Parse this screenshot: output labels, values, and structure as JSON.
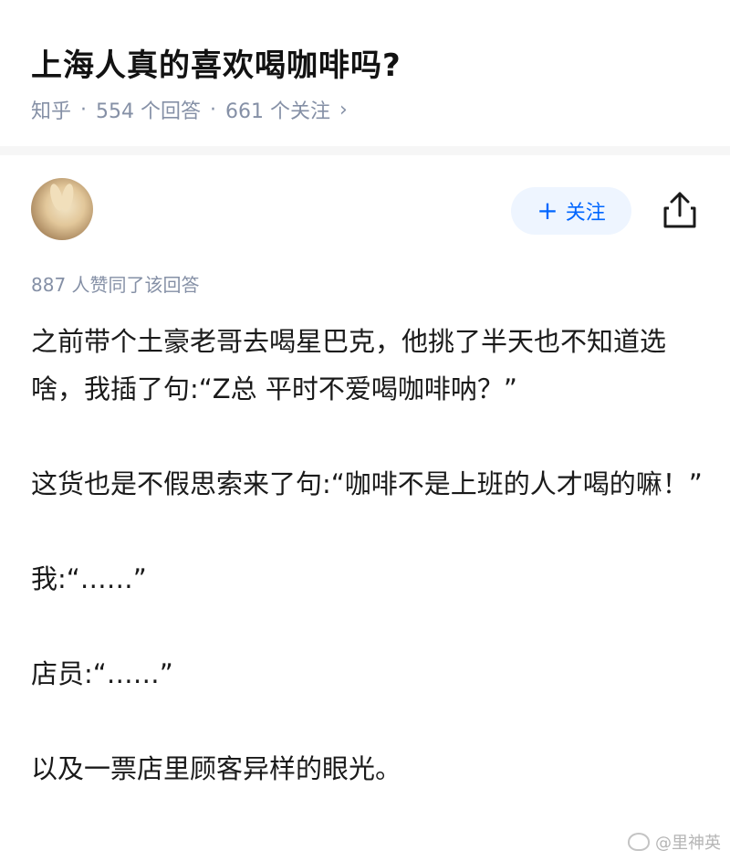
{
  "question": {
    "title": "上海人真的喜欢喝咖啡吗?",
    "source": "知乎",
    "answer_count": "554 个回答",
    "follow_count": "661 个关注",
    "separator": "·",
    "chevron": "›"
  },
  "author": {
    "name": "",
    "bio": "",
    "follow_label": "关注",
    "follow_icon": "+",
    "share_icon": "share-icon"
  },
  "upvote_note": "887 人赞同了该回答",
  "paragraphs": [
    "之前带个土豪老哥去喝星巴克，他挑了半天也不知道选啥，我插了句:“Z总 平时不爱喝咖啡呐？”",
    "这货也是不假思索来了句:“咖啡不是上班的人才喝的嘛！”",
    "我:“……”",
    "店员:“……”",
    "以及一票店里顾客异样的眼光。"
  ],
  "watermark": "@里神英",
  "colors": {
    "accent": "#0066ff",
    "follow_bg": "#eef5ff",
    "meta_text": "#8590a6"
  }
}
